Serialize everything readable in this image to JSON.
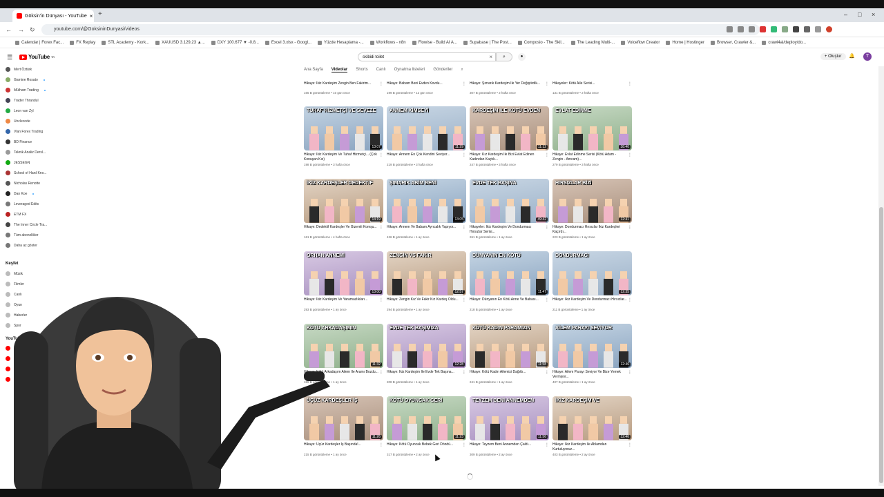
{
  "browser": {
    "tab_title": "Göksin'in Dünyası - YouTube",
    "url": "youtube.com/@GoksininDunyasi/videos",
    "bookmarks": [
      "Calendar | Forex Fac...",
      "FX Replay",
      "STL Academy - Kork...",
      "XAUUSD 3.129,23 ▲...",
      "DXY 100.677 ▼ -0.8...",
      "Excel 3.xlsx - Googl...",
      "Yüzde Hesaplama -...",
      "Workflows - n8n",
      "Flowise - Build AI A...",
      "Supabase | The Post...",
      "Composio - The Skil...",
      "The Leading Multi-...",
      "Voiceflow Creator",
      "Home | Hostinger",
      "Browser, Crawler &...",
      "crawl4ai/deploy/do..."
    ]
  },
  "header": {
    "logo_text": "YouTube",
    "logo_region": "TR",
    "search_value": "skibidi toilet",
    "create_label": "Oluştur",
    "avatar_letter": "T"
  },
  "channel_tabs": [
    "Ana Sayfa",
    "Videolar",
    "Shorts",
    "Canlı",
    "Oynatma listeleri",
    "Gönderiler"
  ],
  "sidebar": {
    "subscriptions": [
      "Mert Öztürk",
      "Gamine Rosato",
      "Mülham Trading",
      "Trader Thrandul",
      "Leon van Zyl",
      "Unclecode",
      "Vlan Forex Trading",
      "BD Finance",
      "Teknik Analiz Dersl...",
      "JESSEGN",
      "School of Hard Kno...",
      "Nicholas Renotte",
      "Dan Koe",
      "Leveraged Edits",
      "ETM FX",
      "The Inner Circle Tra...",
      "Tüm abonelikler",
      "Daha az göster"
    ],
    "explore_title": "Keşfet",
    "explore": [
      "Müzik",
      "Filmler",
      "Canlı",
      "Oyun",
      "Haberler",
      "Spor"
    ],
    "more_title": "YouTube'dan daha fazla...",
    "more": [
      "YouTube Premium",
      "YouTube Studio",
      "YouTube Music",
      "YouTube Kids"
    ]
  },
  "videos": [
    {
      "thumb": "",
      "dur": "",
      "title": "Hikaye: İkiz Kardeşim Zengin Ben Fakirim...",
      "stats": "165 B görüntüleme • 10 gün önce"
    },
    {
      "thumb": "",
      "dur": "",
      "title": "Hikaye: Babam Beni Evden Kovdu...",
      "stats": "199 B görüntüleme • 12 gün önce"
    },
    {
      "thumb": "",
      "dur": "",
      "title": "Hikaye: Şımarık Kardeşim İle Yer Değiştirdik...",
      "stats": "307 B görüntüleme • 2 hafta önce"
    },
    {
      "thumb": "",
      "dur": "",
      "title": "Hikayeler: Kötü Aile Serisi...",
      "stats": "131 B görüntüleme • 2 hafta önce"
    },
    {
      "thumb": "TUHAF HİZMETÇİ VE GEVEZE",
      "dur": "13:07",
      "title": "Hikaye: İkiz Kardeşim Ve Tuhaf Hizmetçi... (Çok Konuşan Kız)",
      "stats": "198 B görüntüleme • 3 hafta önce"
    },
    {
      "thumb": "ANNEM KİMSEYİ",
      "dur": "11:29",
      "title": "Hikaye: Annem En Çok Kendini Seviyor...",
      "stats": "219 B görüntüleme • 3 hafta önce"
    },
    {
      "thumb": "KARDEŞİM İLE KÖTÜ EVDEN",
      "dur": "11:12",
      "title": "Hikaye: Kız Kardeşim İle Bizi Evlat Edinen Kadından Kaçtık...",
      "stats": "247 B görüntüleme • 3 hafta önce"
    },
    {
      "thumb": "EVLAT EDİNME",
      "dur": "38:40",
      "title": "Hikaye: Evlat Edinme Serisi (Kötü Adam - Zengin - Amcam)...",
      "stats": "279 B görüntüleme • 3 hafta önce"
    },
    {
      "thumb": "İKİZ KARDEŞLER DEDEKTİF",
      "dur": "14:19",
      "title": "Hikaye: Dedektif Kardeşler Ve Gizemli Komşu...",
      "stats": "161 B görüntüleme • 4 hafta önce"
    },
    {
      "thumb": "ŞIMARIK ABİM BENİ",
      "dur": "13:05",
      "title": "Hikaye: Annem Ve Babam Ayrıcalık Yapıyor...",
      "stats": "426 B görüntüleme • 1 ay önce"
    },
    {
      "thumb": "EVDE TEK BAŞINA",
      "dur": "49:42",
      "title": "Hikayeler: İkiz Kardeşim Ve Dondurmacı Hırsızlar Serisi...",
      "stats": "261 B görüntüleme • 1 ay önce"
    },
    {
      "thumb": "HIRSIZLAR BİZİ",
      "dur": "12:41",
      "title": "Hikaye: Dondurmacı Hırsızlar İkiz Kardeşleri Kaçırdı...",
      "stats": "223 B görüntüleme • 1 ay önce"
    },
    {
      "thumb": "ORHAN ANNEMİ",
      "dur": "13:00",
      "title": "Hikaye: İkiz Kardeşim Ve Yaramazlıkları...",
      "stats": "293 B görüntüleme • 1 ay önce"
    },
    {
      "thumb": "ZENGİN VS FAKİR",
      "dur": "12:57",
      "title": "Hikaye: Zengin Kız Ve Fakir Kız Kardeş Oldu...",
      "stats": "294 B görüntüleme • 1 ay önce"
    },
    {
      "thumb": "DÜNYANIN EN KÖTÜ",
      "dur": "11:47",
      "title": "Hikaye: Dünyanın En Kötü Anne Ve Babası...",
      "stats": "218 B görüntüleme • 1 ay önce"
    },
    {
      "thumb": "DONDURMACI",
      "dur": "12:35",
      "title": "Hikaye: İkiz Kardeşim Ve Dondurmacı Hırsızlar...",
      "stats": "211 B görüntüleme • 1 ay önce"
    },
    {
      "thumb": "KÖTÜ ARKADAŞIMIN",
      "dur": "11:32",
      "title": "Hikaye: Kötü Arkadaşım Ailem İle Aramı Bozdu...",
      "stats": "189 B görüntüleme • 1 ay önce"
    },
    {
      "thumb": "EVDE TEK BAŞIMIZA",
      "dur": "12:28",
      "title": "Hikaye: İkiz Kardeşim İle Evde Tek Başına...",
      "stats": "208 B görüntüleme • 1 ay önce"
    },
    {
      "thumb": "KÖTÜ KADIN PARAMIZIN",
      "dur": "11:58",
      "title": "Hikaye: Kötü Kadın Ailemizi Dağıttı...",
      "stats": "241 B görüntüleme • 1 ay önce"
    },
    {
      "thumb": "AİLEM PARAYI SEVİYOR",
      "dur": "12:46",
      "title": "Hikaye: Ailem Parayı Seviyor Ve Bize Yemek Vermiyor...",
      "stats": "407 B görüntüleme • 1 ay önce"
    },
    {
      "thumb": "ÜÇÜZ KARDEŞLER İŞ",
      "dur": "11:26",
      "title": "Hikaye: Üçüz Kardeşler İş Başında!...",
      "stats": "215 B görüntüleme • 1 ay önce"
    },
    {
      "thumb": "KÖTÜ OYUNCAK GERİ",
      "dur": "11:23",
      "title": "Hikaye: Kötü Oyuncak Bebek Geri Döndü...",
      "stats": "317 B görüntüleme • 2 ay önce"
    },
    {
      "thumb": "TEYZEM BENİ ANNEMDEN",
      "dur": "11:56",
      "title": "Hikaye: Teyzem Beni Annemden Çaldı...",
      "stats": "309 B görüntüleme • 2 ay önce"
    },
    {
      "thumb": "İKİZ KARDEŞİM VE",
      "dur": "12:46",
      "title": "Hikaye: İkiz Kardeşim İle Ablamdan Kurtuluyoruz...",
      "stats": "403 B görüntüleme • 2 ay önce"
    }
  ],
  "colors": {
    "brand": "#ff0000",
    "accent_red": "#ff2d2d"
  }
}
